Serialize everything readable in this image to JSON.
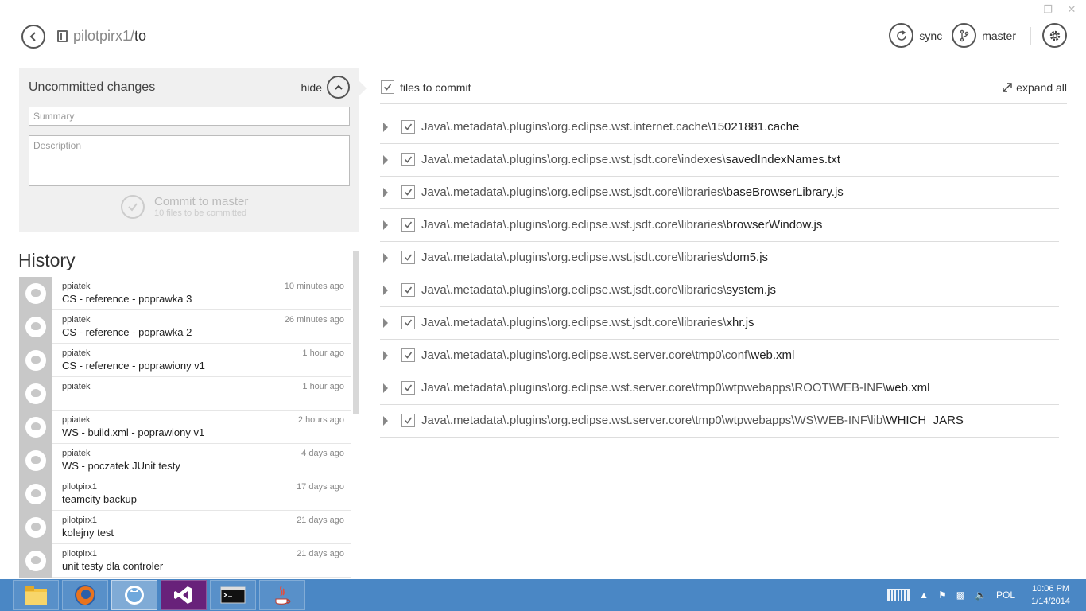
{
  "header": {
    "repo_owner": "pilotpirx1/",
    "repo_name": "to",
    "sync_label": "sync",
    "branch_label": "master"
  },
  "uncommitted": {
    "title": "Uncommitted changes",
    "hide_label": "hide",
    "summary_placeholder": "Summary",
    "description_placeholder": "Description",
    "commit_label": "Commit to master",
    "commit_sub": "10 files to be committed"
  },
  "history": {
    "title": "History",
    "items": [
      {
        "author": "ppiatek",
        "message": "CS - reference - poprawka 3",
        "time": "10 minutes ago"
      },
      {
        "author": "ppiatek",
        "message": "CS - reference - poprawka 2",
        "time": "26 minutes ago"
      },
      {
        "author": "ppiatek",
        "message": "CS - reference - poprawiony v1",
        "time": "1 hour ago"
      },
      {
        "author": "ppiatek",
        "message": "",
        "time": "1 hour ago"
      },
      {
        "author": "ppiatek",
        "message": "WS - build.xml - poprawiony v1",
        "time": "2 hours ago"
      },
      {
        "author": "ppiatek",
        "message": "WS - poczatek JUnit testy",
        "time": "4 days ago"
      },
      {
        "author": "pilotpirx1",
        "message": "teamcity backup",
        "time": "17 days ago"
      },
      {
        "author": "pilotpirx1",
        "message": "kolejny test",
        "time": "21 days ago"
      },
      {
        "author": "pilotpirx1",
        "message": "unit testy dla controler",
        "time": "21 days ago"
      }
    ]
  },
  "files": {
    "header_label": "files to commit",
    "expand_label": "expand all",
    "items": [
      {
        "dir": "Java\\.metadata\\.plugins\\org.eclipse.wst.internet.cache\\",
        "name": "15021881.cache"
      },
      {
        "dir": "Java\\.metadata\\.plugins\\org.eclipse.wst.jsdt.core\\indexes\\",
        "name": "savedIndexNames.txt"
      },
      {
        "dir": "Java\\.metadata\\.plugins\\org.eclipse.wst.jsdt.core\\libraries\\",
        "name": "baseBrowserLibrary.js"
      },
      {
        "dir": "Java\\.metadata\\.plugins\\org.eclipse.wst.jsdt.core\\libraries\\",
        "name": "browserWindow.js"
      },
      {
        "dir": "Java\\.metadata\\.plugins\\org.eclipse.wst.jsdt.core\\libraries\\",
        "name": "dom5.js"
      },
      {
        "dir": "Java\\.metadata\\.plugins\\org.eclipse.wst.jsdt.core\\libraries\\",
        "name": "system.js"
      },
      {
        "dir": "Java\\.metadata\\.plugins\\org.eclipse.wst.jsdt.core\\libraries\\",
        "name": "xhr.js"
      },
      {
        "dir": "Java\\.metadata\\.plugins\\org.eclipse.wst.server.core\\tmp0\\conf\\",
        "name": "web.xml"
      },
      {
        "dir": "Java\\.metadata\\.plugins\\org.eclipse.wst.server.core\\tmp0\\wtpwebapps\\ROOT\\WEB-INF\\",
        "name": "web.xml"
      },
      {
        "dir": "Java\\.metadata\\.plugins\\org.eclipse.wst.server.core\\tmp0\\wtpwebapps\\WS\\WEB-INF\\lib\\",
        "name": "WHICH_JARS"
      }
    ]
  },
  "taskbar": {
    "language": "POL",
    "time": "10:06 PM",
    "date": "1/14/2014"
  }
}
